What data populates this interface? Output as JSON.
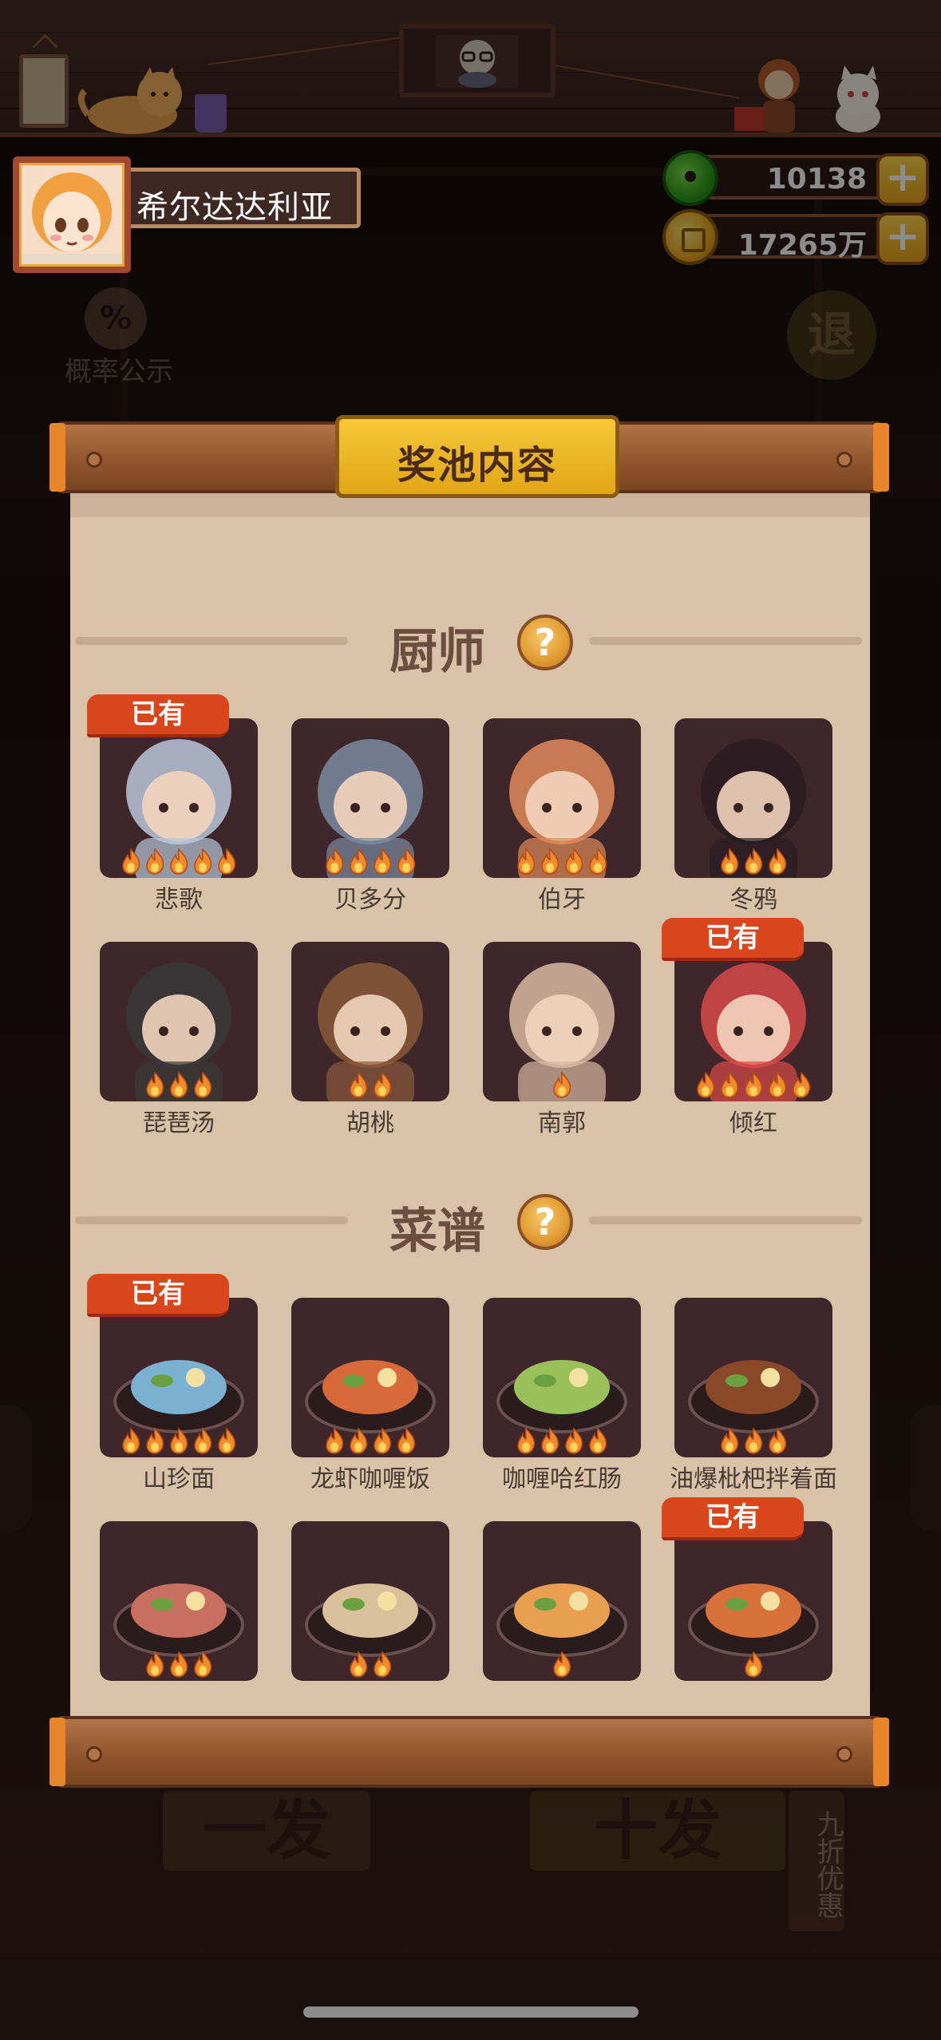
{
  "player": {
    "name": "希尔达达利亚"
  },
  "currencies": [
    {
      "type": "jade",
      "value": "10138"
    },
    {
      "type": "gold",
      "value": "17265万"
    }
  ],
  "background": {
    "probability_label": "概率公示",
    "probability_icon": "%",
    "back_label": "退",
    "draw_once": "一发",
    "draw_ten": "十发",
    "discount": "九折优惠"
  },
  "modal": {
    "title": "奖池内容",
    "owned_label": "已有",
    "help_label": "?",
    "sections": [
      {
        "title": "厨师",
        "items": [
          {
            "name": "悲歌",
            "stars": 5,
            "owned": true,
            "color": "#b8c6d8"
          },
          {
            "name": "贝多分",
            "stars": 4,
            "owned": false,
            "color": "#7a8aa0"
          },
          {
            "name": "伯牙",
            "stars": 4,
            "owned": false,
            "color": "#e08a5a"
          },
          {
            "name": "冬鸦",
            "stars": 3,
            "owned": false,
            "color": "#2a1c22"
          },
          {
            "name": "琵琶汤",
            "stars": 3,
            "owned": false,
            "color": "#3a3a3a"
          },
          {
            "name": "胡桃",
            "stars": 2,
            "owned": false,
            "color": "#8a5a3a"
          },
          {
            "name": "南郭",
            "stars": 1,
            "owned": false,
            "color": "#d8b8a0"
          },
          {
            "name": "倾红",
            "stars": 5,
            "owned": true,
            "color": "#d84a4a"
          }
        ]
      },
      {
        "title": "菜谱",
        "items": [
          {
            "name": "山珍面",
            "stars": 5,
            "owned": true,
            "color": "#7ab0d0"
          },
          {
            "name": "龙虾咖喱饭",
            "stars": 4,
            "owned": false,
            "color": "#d86a3a"
          },
          {
            "name": "咖喱哈红肠",
            "stars": 4,
            "owned": false,
            "color": "#9ac05a"
          },
          {
            "name": "油爆枇杷拌着面",
            "stars": 3,
            "owned": false,
            "color": "#8a4a2a"
          },
          {
            "name": "",
            "stars": 3,
            "owned": false,
            "color": "#c87060"
          },
          {
            "name": "",
            "stars": 2,
            "owned": false,
            "color": "#d8c09a"
          },
          {
            "name": "",
            "stars": 1,
            "owned": false,
            "color": "#e8a050"
          },
          {
            "name": "",
            "stars": 1,
            "owned": true,
            "color": "#d8703a"
          }
        ]
      }
    ]
  },
  "colors": {
    "owned_badge": "#d9461c",
    "card_bg": "#3e262a",
    "paper": "#d8c2a8",
    "title_plate": "#f6c83a",
    "flame": "#f08a2a"
  }
}
